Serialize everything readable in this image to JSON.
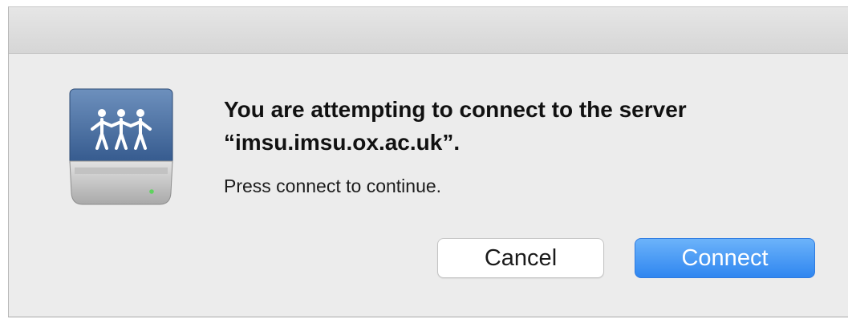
{
  "dialog": {
    "title_line1": "You are attempting to connect to the server",
    "title_line2": "“imsu.imsu.ox.ac.uk”.",
    "detail": "Press connect to continue.",
    "icon": "shared-network-drive-icon"
  },
  "buttons": {
    "cancel_label": "Cancel",
    "connect_label": "Connect"
  },
  "colors": {
    "dialog_background": "#ececec",
    "primary_button": "#3d90f3",
    "drive_face": "#3f6496"
  }
}
